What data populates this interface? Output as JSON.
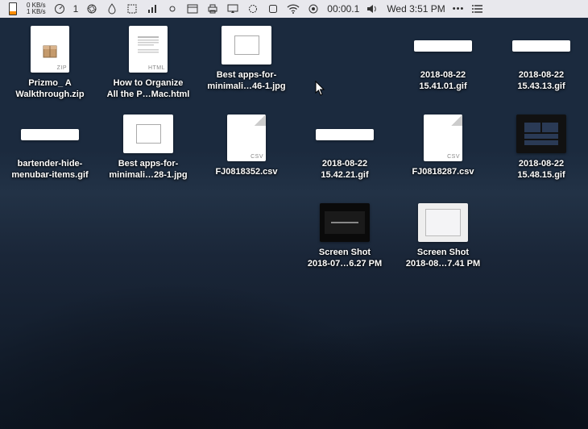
{
  "menubar": {
    "netstat_top": "0 KB/s",
    "netstat_bottom": "1 KB/s",
    "counter": "1",
    "timer": "00:00.1",
    "datetime": "Wed 3:51 PM",
    "ellipsis": "•••"
  },
  "files": {
    "r1c1": "Prizmo_ A\nWalkthrough.zip",
    "r1c2": "How to Organize\nAll the P…Mac.html",
    "r1c3": "Best apps-for-\nminimali…46-1.jpg",
    "r1c5": "2018-08-22\n15.41.01.gif",
    "r1c6": "2018-08-22\n15.43.13.gif",
    "r2c1": "bartender-hide-\nmenubar-items.gif",
    "r2c2": "Best apps-for-\nminimali…28-1.jpg",
    "r2c3": "FJ0818352.csv",
    "r2c4": "2018-08-22\n15.42.21.gif",
    "r2c5": "FJ0818287.csv",
    "r2c6": "2018-08-22\n15.48.15.gif",
    "r3c4": "Screen Shot\n2018-07…6.27 PM",
    "r3c5": "Screen Shot\n2018-08…7.41 PM"
  },
  "badges": {
    "zip": "ZIP",
    "html": "HTML",
    "csv": "CSV"
  }
}
